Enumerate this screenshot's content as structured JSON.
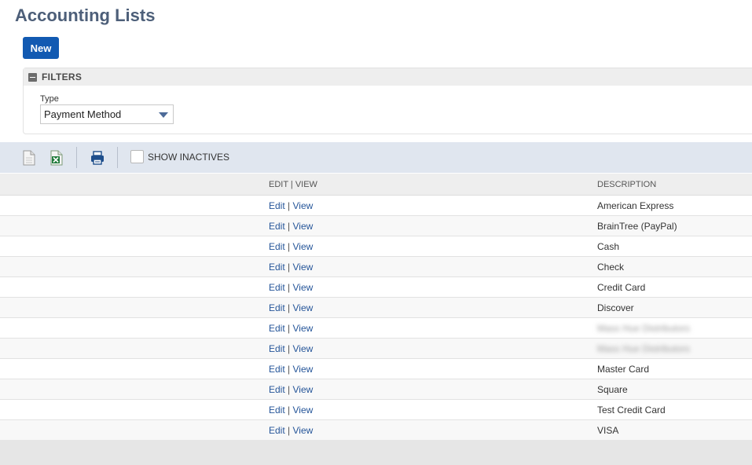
{
  "page": {
    "title": "Accounting Lists"
  },
  "actions": {
    "new_label": "New"
  },
  "filters": {
    "title": "FILTERS",
    "type_label": "Type",
    "type_value": "Payment Method"
  },
  "toolbar": {
    "show_inactives_label": "SHOW INACTIVES"
  },
  "table": {
    "columns": {
      "edit_view": "Edit | View",
      "description": "Description"
    },
    "edit_label": "Edit",
    "separator": "|",
    "view_label": "View",
    "rows": [
      {
        "description": "American Express"
      },
      {
        "description": "BrainTree (PayPal)"
      },
      {
        "description": "Cash"
      },
      {
        "description": "Check"
      },
      {
        "description": "Credit Card"
      },
      {
        "description": "Discover"
      },
      {
        "description": "Mass Hue Distributors"
      },
      {
        "description": "Mass Hue Distributors"
      },
      {
        "description": "Master Card"
      },
      {
        "description": "Square"
      },
      {
        "description": "Test Credit Card"
      },
      {
        "description": "VISA"
      }
    ]
  }
}
